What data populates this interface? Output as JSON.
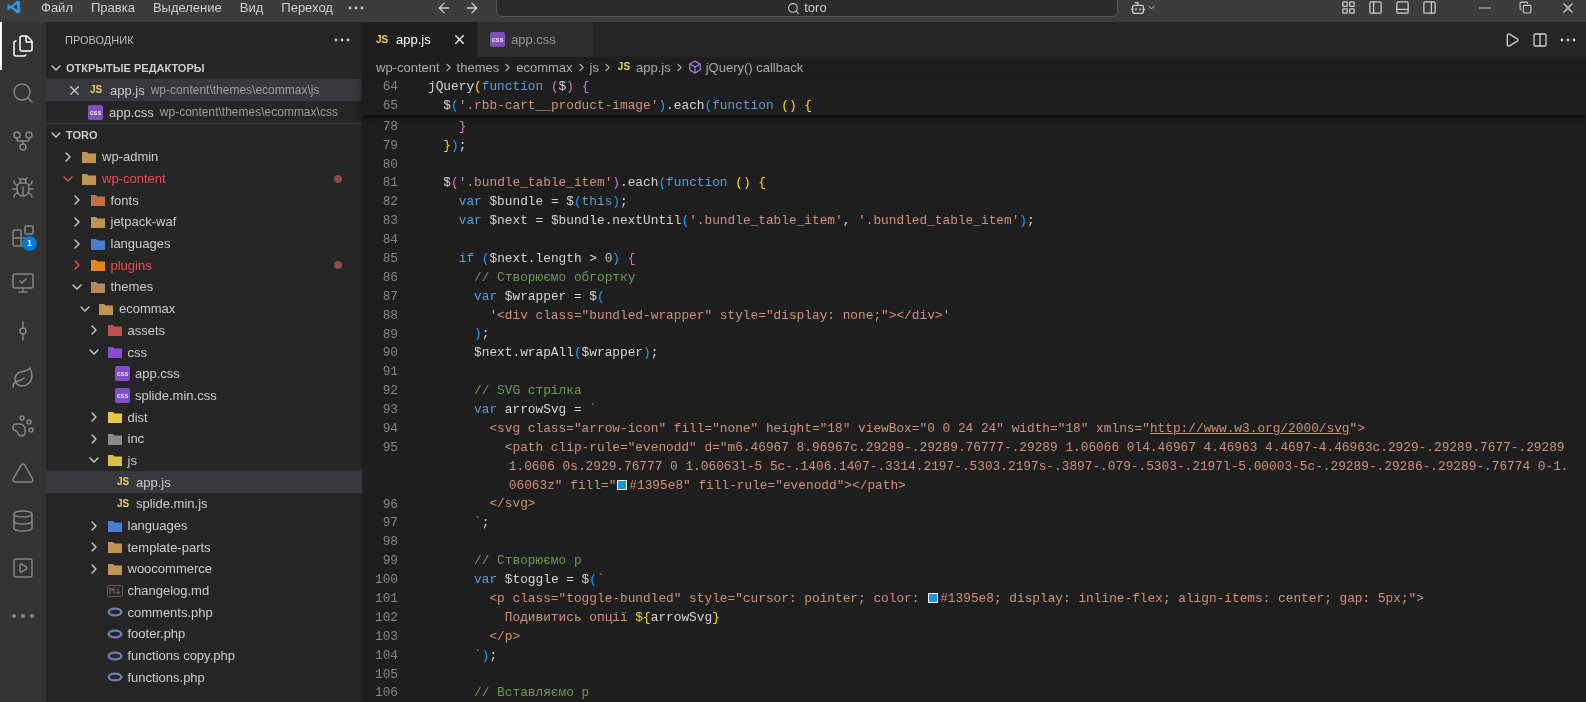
{
  "title_bar": {
    "menu": [
      "Файл",
      "Правка",
      "Выделение",
      "Вид",
      "Переход"
    ],
    "search": {
      "value": "toro"
    }
  },
  "activity_bar": [
    {
      "kind": "explorer",
      "selected": true
    },
    {
      "kind": "search",
      "selected": false
    },
    {
      "kind": "source-control",
      "selected": false
    },
    {
      "kind": "debug",
      "selected": false
    },
    {
      "kind": "extensions",
      "selected": false,
      "badge": "1"
    },
    {
      "kind": "remote",
      "selected": false
    },
    {
      "kind": "git-graph",
      "selected": false
    },
    {
      "kind": "leaf",
      "selected": false
    },
    {
      "kind": "paw",
      "selected": false
    },
    {
      "kind": "triangle",
      "selected": false
    },
    {
      "kind": "database",
      "selected": false
    },
    {
      "kind": "play-box",
      "selected": false
    },
    {
      "kind": "more",
      "selected": false
    }
  ],
  "sidebar": {
    "title": "ПРОВОДНИК",
    "open_editors": {
      "title": "ОТКРЫТЫЕ РЕДАКТОРЫ",
      "expanded": true,
      "items": [
        {
          "name": "app.js",
          "kind": "js",
          "icon_label": "JS",
          "path": "wp-content\\themes\\ecommax\\js",
          "selected": true
        },
        {
          "name": "app.css",
          "kind": "css",
          "icon_label": "css",
          "path": "wp-content\\themes\\ecommax\\css",
          "selected": false
        }
      ]
    },
    "tree": {
      "name": "TORO",
      "expanded": true,
      "children": [
        {
          "name": "wp-admin",
          "kind": "folder",
          "color": "#c09553",
          "expanded": false,
          "modified": false,
          "selected": false
        },
        {
          "name": "wp-content",
          "kind": "folder",
          "color": "#c09553",
          "expanded": true,
          "modified": true,
          "selected": false,
          "children": [
            {
              "name": "fonts",
              "kind": "folder",
              "color": "#c2703d",
              "expanded": false,
              "modified": false,
              "selected": false
            },
            {
              "name": "jetpack-waf",
              "kind": "folder",
              "color": "#c09553",
              "expanded": false,
              "modified": false,
              "selected": false
            },
            {
              "name": "languages",
              "kind": "folder",
              "color": "#4a7fd0",
              "expanded": false,
              "modified": false,
              "selected": false
            },
            {
              "name": "plugins",
              "kind": "folder",
              "color": "#e8841c",
              "expanded": false,
              "modified": true,
              "selected": false
            },
            {
              "name": "themes",
              "kind": "folder",
              "color": "#b58a5a",
              "expanded": true,
              "modified": false,
              "selected": false,
              "children": [
                {
                  "name": "ecommax",
                  "kind": "folder",
                  "color": "#c09553",
                  "expanded": true,
                  "modified": false,
                  "selected": false,
                  "children": [
                    {
                      "name": "assets",
                      "kind": "folder",
                      "color": "#c0504d",
                      "expanded": false,
                      "modified": false,
                      "selected": false
                    },
                    {
                      "name": "css",
                      "kind": "folder",
                      "color": "#8a4bd0",
                      "expanded": true,
                      "modified": false,
                      "selected": false,
                      "children": [
                        {
                          "name": "app.css",
                          "kind": "css",
                          "icon_label": "css",
                          "modified": false,
                          "selected": false
                        },
                        {
                          "name": "splide.min.css",
                          "kind": "css",
                          "icon_label": "css",
                          "modified": false,
                          "selected": false
                        }
                      ]
                    },
                    {
                      "name": "dist",
                      "kind": "folder",
                      "color": "#e8c547",
                      "expanded": false,
                      "modified": false,
                      "selected": false
                    },
                    {
                      "name": "inc",
                      "kind": "folder",
                      "color": "#8a8a8a",
                      "expanded": false,
                      "modified": false,
                      "selected": false
                    },
                    {
                      "name": "js",
                      "kind": "folder",
                      "color": "#d8c04a",
                      "expanded": true,
                      "modified": false,
                      "selected": false,
                      "children": [
                        {
                          "name": "app.js",
                          "kind": "js",
                          "icon_label": "JS",
                          "modified": false,
                          "selected": true
                        },
                        {
                          "name": "splide.min.js",
                          "kind": "js",
                          "icon_label": "JS",
                          "modified": false,
                          "selected": false
                        }
                      ]
                    },
                    {
                      "name": "languages",
                      "kind": "folder",
                      "color": "#4a7fd0",
                      "expanded": false,
                      "modified": false,
                      "selected": false
                    },
                    {
                      "name": "template-parts",
                      "kind": "folder",
                      "color": "#c09553",
                      "expanded": false,
                      "modified": false,
                      "selected": false
                    },
                    {
                      "name": "woocommerce",
                      "kind": "folder",
                      "color": "#c09553",
                      "expanded": false,
                      "modified": false,
                      "selected": false
                    },
                    {
                      "name": "changelog.md",
                      "kind": "md",
                      "modified": false,
                      "selected": false
                    },
                    {
                      "name": "comments.php",
                      "kind": "php",
                      "modified": false,
                      "selected": false
                    },
                    {
                      "name": "footer.php",
                      "kind": "php",
                      "modified": false,
                      "selected": false
                    },
                    {
                      "name": "functions copy.php",
                      "kind": "php",
                      "modified": false,
                      "selected": false
                    },
                    {
                      "name": "functions.php",
                      "kind": "php",
                      "modified": false,
                      "selected": false
                    }
                  ]
                }
              ]
            }
          ]
        }
      ]
    }
  },
  "tabs": [
    {
      "label": "app.js",
      "kind": "js",
      "icon_label": "JS",
      "selected": true
    },
    {
      "label": "app.css",
      "kind": "css",
      "icon_label": "css",
      "selected": false
    }
  ],
  "breadcrumbs": [
    {
      "label": "wp-content",
      "kind": "folder"
    },
    {
      "label": "themes",
      "kind": "folder"
    },
    {
      "label": "ecommax",
      "kind": "folder"
    },
    {
      "label": "js",
      "kind": "folder"
    },
    {
      "label": "app.js",
      "kind": "js",
      "icon_label": "JS"
    },
    {
      "label": "jQuery() callback",
      "kind": "symbol"
    }
  ],
  "sticky_lines": [
    {
      "number": "64",
      "tokens": [
        {
          "kind": "plain",
          "text": "jQuery"
        },
        {
          "kind": "b1",
          "text": "("
        },
        {
          "kind": "kw",
          "text": "function "
        },
        {
          "kind": "b2",
          "text": "("
        },
        {
          "kind": "plain",
          "text": "$"
        },
        {
          "kind": "b2",
          "text": ") "
        },
        {
          "kind": "b2",
          "text": "{"
        }
      ]
    },
    {
      "number": "65",
      "tokens": [
        {
          "kind": "plain",
          "text": "  $"
        },
        {
          "kind": "b3",
          "text": "("
        },
        {
          "kind": "str",
          "text": "'.rbb-cart__product-image'"
        },
        {
          "kind": "b3",
          "text": ")"
        },
        {
          "kind": "plain",
          "text": ".each"
        },
        {
          "kind": "b3",
          "text": "("
        },
        {
          "kind": "kw",
          "text": "function "
        },
        {
          "kind": "b1",
          "text": "() "
        },
        {
          "kind": "b1",
          "text": "{"
        }
      ]
    }
  ],
  "lines": [
    {
      "number": "78",
      "tokens": [
        {
          "kind": "b2",
          "text": "    }"
        }
      ]
    },
    {
      "number": "79",
      "tokens": [
        {
          "kind": "b1",
          "text": "  }"
        },
        {
          "kind": "b3",
          "text": ")"
        },
        {
          "kind": "plain",
          "text": ";"
        }
      ]
    },
    {
      "number": "80"
    },
    {
      "number": "81",
      "tokens": [
        {
          "kind": "plain",
          "text": "  $"
        },
        {
          "kind": "b2",
          "text": "("
        },
        {
          "kind": "str",
          "text": "'.bundle_table_item'"
        },
        {
          "kind": "b2",
          "text": ")"
        },
        {
          "kind": "plain",
          "text": ".each"
        },
        {
          "kind": "b3",
          "text": "("
        },
        {
          "kind": "kw",
          "text": "function "
        },
        {
          "kind": "b1",
          "text": "() "
        },
        {
          "kind": "b1",
          "text": "{"
        }
      ]
    },
    {
      "number": "82",
      "tokens": [
        {
          "kind": "kw",
          "text": "    var"
        },
        {
          "kind": "plain",
          "text": " $bundle = $"
        },
        {
          "kind": "b3",
          "text": "("
        },
        {
          "kind": "kw",
          "text": "this"
        },
        {
          "kind": "b3",
          "text": ")"
        },
        {
          "kind": "plain",
          "text": ";"
        }
      ]
    },
    {
      "number": "83",
      "tokens": [
        {
          "kind": "kw",
          "text": "    var"
        },
        {
          "kind": "plain",
          "text": " $next = $bundle.nextUntil"
        },
        {
          "kind": "b3",
          "text": "("
        },
        {
          "kind": "str",
          "text": "'.bundle_table_item'"
        },
        {
          "kind": "plain",
          "text": ", "
        },
        {
          "kind": "str",
          "text": "'.bundled_table_item'"
        },
        {
          "kind": "b3",
          "text": ")"
        },
        {
          "kind": "plain",
          "text": ";"
        }
      ]
    },
    {
      "number": "84"
    },
    {
      "number": "85",
      "tokens": [
        {
          "kind": "kw",
          "text": "    if "
        },
        {
          "kind": "b3",
          "text": "("
        },
        {
          "kind": "plain",
          "text": "$next.length > "
        },
        {
          "kind": "num",
          "text": "0"
        },
        {
          "kind": "b3",
          "text": ") "
        },
        {
          "kind": "b2",
          "text": "{"
        }
      ]
    },
    {
      "number": "86",
      "tokens": [
        {
          "kind": "cmt",
          "text": "      // Створюємо обгортку"
        }
      ]
    },
    {
      "number": "87",
      "tokens": [
        {
          "kind": "kw",
          "text": "      var"
        },
        {
          "kind": "plain",
          "text": " $wrapper = $"
        },
        {
          "kind": "b3",
          "text": "("
        }
      ]
    },
    {
      "number": "88",
      "tokens": [
        {
          "kind": "str",
          "text": "        '<div class=\"bundled-wrapper\" style=\"display: none;\"></div>'"
        }
      ]
    },
    {
      "number": "89",
      "tokens": [
        {
          "kind": "b3",
          "text": "      )"
        },
        {
          "kind": "plain",
          "text": ";"
        }
      ]
    },
    {
      "number": "90",
      "tokens": [
        {
          "kind": "plain",
          "text": "      $next.wrapAll"
        },
        {
          "kind": "b3",
          "text": "("
        },
        {
          "kind": "plain",
          "text": "$wrapper"
        },
        {
          "kind": "b3",
          "text": ")"
        },
        {
          "kind": "plain",
          "text": ";"
        }
      ]
    },
    {
      "number": "91"
    },
    {
      "number": "92",
      "tokens": [
        {
          "kind": "cmt",
          "text": "      // SVG стрілка"
        }
      ]
    },
    {
      "number": "93",
      "tokens": [
        {
          "kind": "kw",
          "text": "      var"
        },
        {
          "kind": "plain",
          "text": " arrowSvg = "
        },
        {
          "kind": "str",
          "text": "`"
        }
      ]
    },
    {
      "number": "94",
      "tokens": [
        {
          "kind": "str",
          "text": "        <svg class=\"arrow-icon\" fill=\"none\" height=\"18\" viewBox=\"0 0 24 24\" width=\"18\" xmlns=\""
        },
        {
          "kind": "link",
          "text": "http://www.w3.org/2000/svg"
        },
        {
          "kind": "str",
          "text": "\">"
        }
      ]
    },
    {
      "number": "95",
      "tokens": [
        {
          "kind": "str",
          "text": "          <path clip-rule=\"evenodd\" d=\"m6.46967 8.96967c.29289-.29289.76777-.29289 1.06066 0l4.46967 4.46963 4.4697-4.46963c.2929-.29289.7677-.29289"
        }
      ]
    },
    {
      "tokens": [
        {
          "kind": "str",
          "text": "          1.0606 0s.2929.76777 0 1.06063l-5 5c-.1406.1407-.3314.2197-.5303.2197s-.3897-.079-.5303-.2197l-5.00003-5c-.29289-.29286-.29289-.76774 0-1."
        }
      ]
    },
    {
      "tokens": [
        {
          "kind": "str",
          "text": "          06063z\" fill=\""
        },
        {
          "kind": "color",
          "text": "#1395e8",
          "color": "#1395e8"
        },
        {
          "kind": "str",
          "text": "\" fill-rule=\"evenodd\"></path>"
        }
      ]
    },
    {
      "number": "96",
      "tokens": [
        {
          "kind": "str",
          "text": "        </svg>"
        }
      ]
    },
    {
      "number": "97",
      "tokens": [
        {
          "kind": "str",
          "text": "      `"
        },
        {
          "kind": "plain",
          "text": ";"
        }
      ]
    },
    {
      "number": "98"
    },
    {
      "number": "99",
      "tokens": [
        {
          "kind": "cmt",
          "text": "      // Створюємо p"
        }
      ]
    },
    {
      "number": "100",
      "tokens": [
        {
          "kind": "kw",
          "text": "      var"
        },
        {
          "kind": "plain",
          "text": " $toggle = $"
        },
        {
          "kind": "b3",
          "text": "("
        },
        {
          "kind": "str",
          "text": "`"
        }
      ]
    },
    {
      "number": "101",
      "tokens": [
        {
          "kind": "str",
          "text": "        <p class=\"toggle-bundled\" style=\"cursor: pointer; color: "
        },
        {
          "kind": "color",
          "text": "#1395e8",
          "color": "#1395e8"
        },
        {
          "kind": "str",
          "text": "; display: inline-flex; align-items: center; gap: 5px;\">"
        }
      ]
    },
    {
      "number": "102",
      "tokens": [
        {
          "kind": "str",
          "text": "          Подивитись опції "
        },
        {
          "kind": "b1",
          "text": "${"
        },
        {
          "kind": "plain",
          "text": "arrowSvg"
        },
        {
          "kind": "b1",
          "text": "}"
        }
      ]
    },
    {
      "number": "103",
      "tokens": [
        {
          "kind": "str",
          "text": "        </p>"
        }
      ]
    },
    {
      "number": "104",
      "tokens": [
        {
          "kind": "str",
          "text": "      `"
        },
        {
          "kind": "b3",
          "text": ")"
        },
        {
          "kind": "plain",
          "text": ";"
        }
      ]
    },
    {
      "number": "105"
    },
    {
      "number": "106",
      "tokens": [
        {
          "kind": "cmt",
          "text": "      // Вставляємо p"
        }
      ]
    }
  ]
}
